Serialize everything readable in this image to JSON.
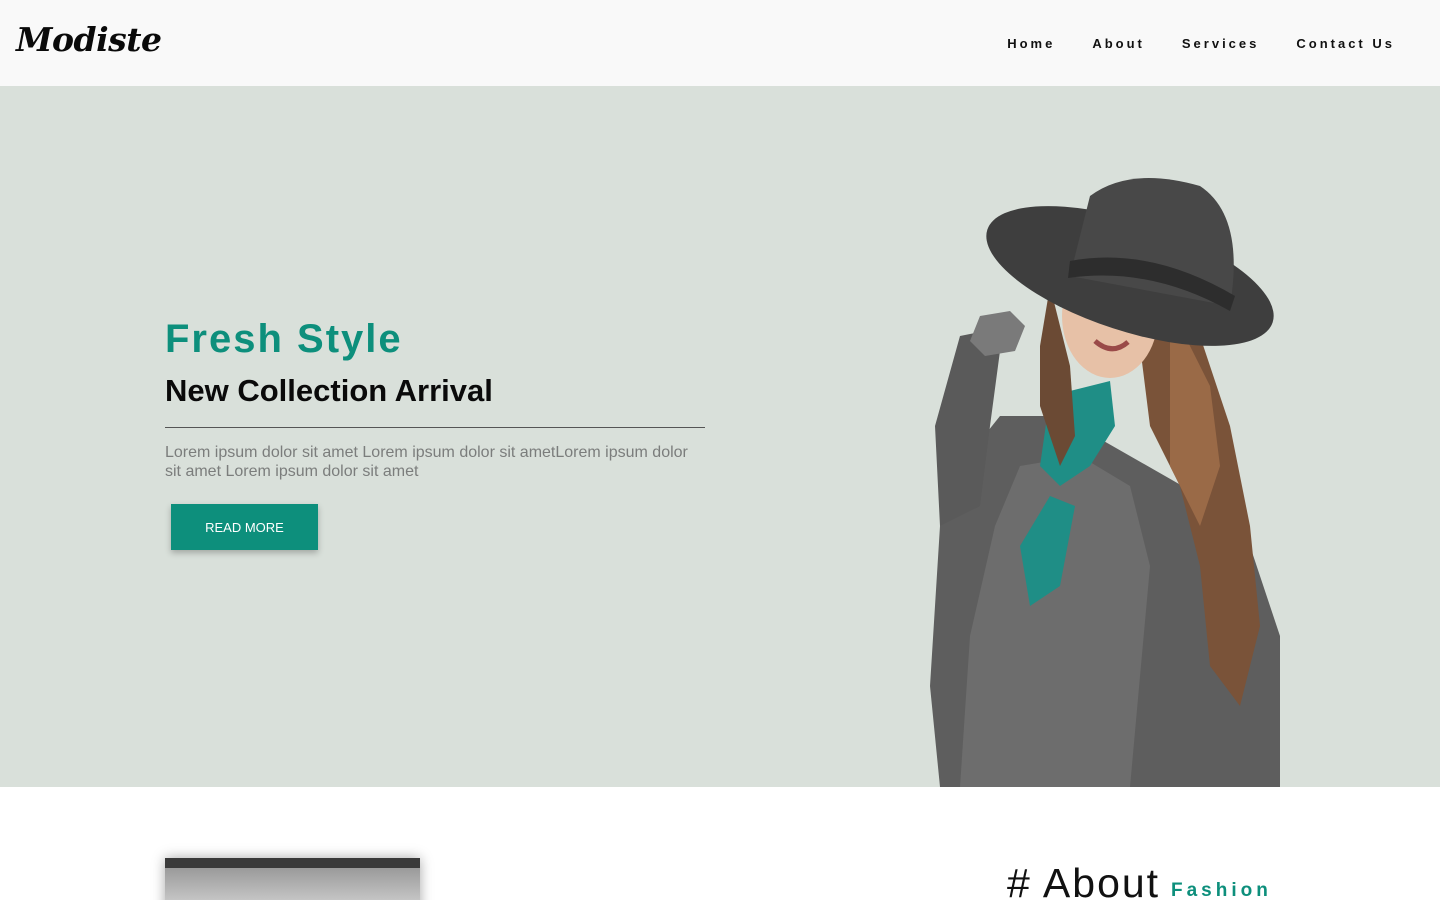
{
  "header": {
    "logo": "Modiste",
    "nav": [
      "Home",
      "About",
      "Services",
      "Contact Us"
    ]
  },
  "hero": {
    "title": "Fresh Style",
    "subtitle": "New Collection Arrival",
    "text": "Lorem ipsum dolor sit amet Lorem ipsum dolor sit ametLorem ipsum dolor sit amet Lorem ipsum dolor sit amet",
    "button": "READ MORE"
  },
  "about": {
    "heading": "# About",
    "subheading": "Fashion"
  },
  "colors": {
    "accent": "#0d8f7c",
    "hero_bg": "#d9e0da",
    "header_bg": "#f9f9f9"
  }
}
